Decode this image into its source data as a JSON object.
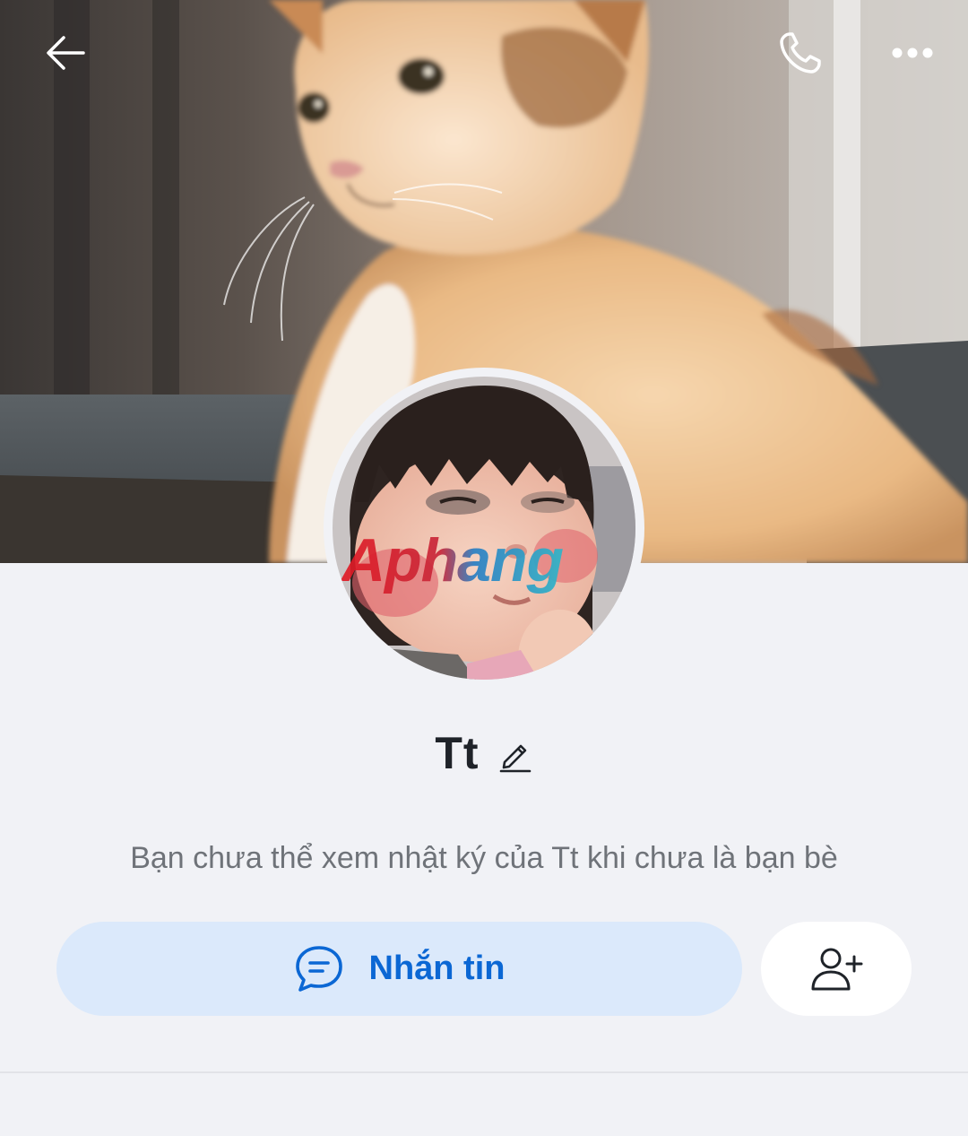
{
  "header": {
    "back_icon": "arrow-left-icon",
    "call_icon": "phone-icon",
    "more_icon": "more-dots-icon"
  },
  "profile": {
    "name": "Tt",
    "edit_icon": "pencil-icon",
    "notice": "Bạn chưa thể xem nhật ký của Tt khi chưa là bạn bè",
    "watermark": "Aphang"
  },
  "actions": {
    "message_label": "Nhắn tin",
    "message_icon": "chat-bubble-icon",
    "add_friend_icon": "add-friend-icon"
  },
  "colors": {
    "background": "#f1f2f6",
    "accent": "#0b67d4",
    "message_button_bg": "#dbe9fb"
  }
}
